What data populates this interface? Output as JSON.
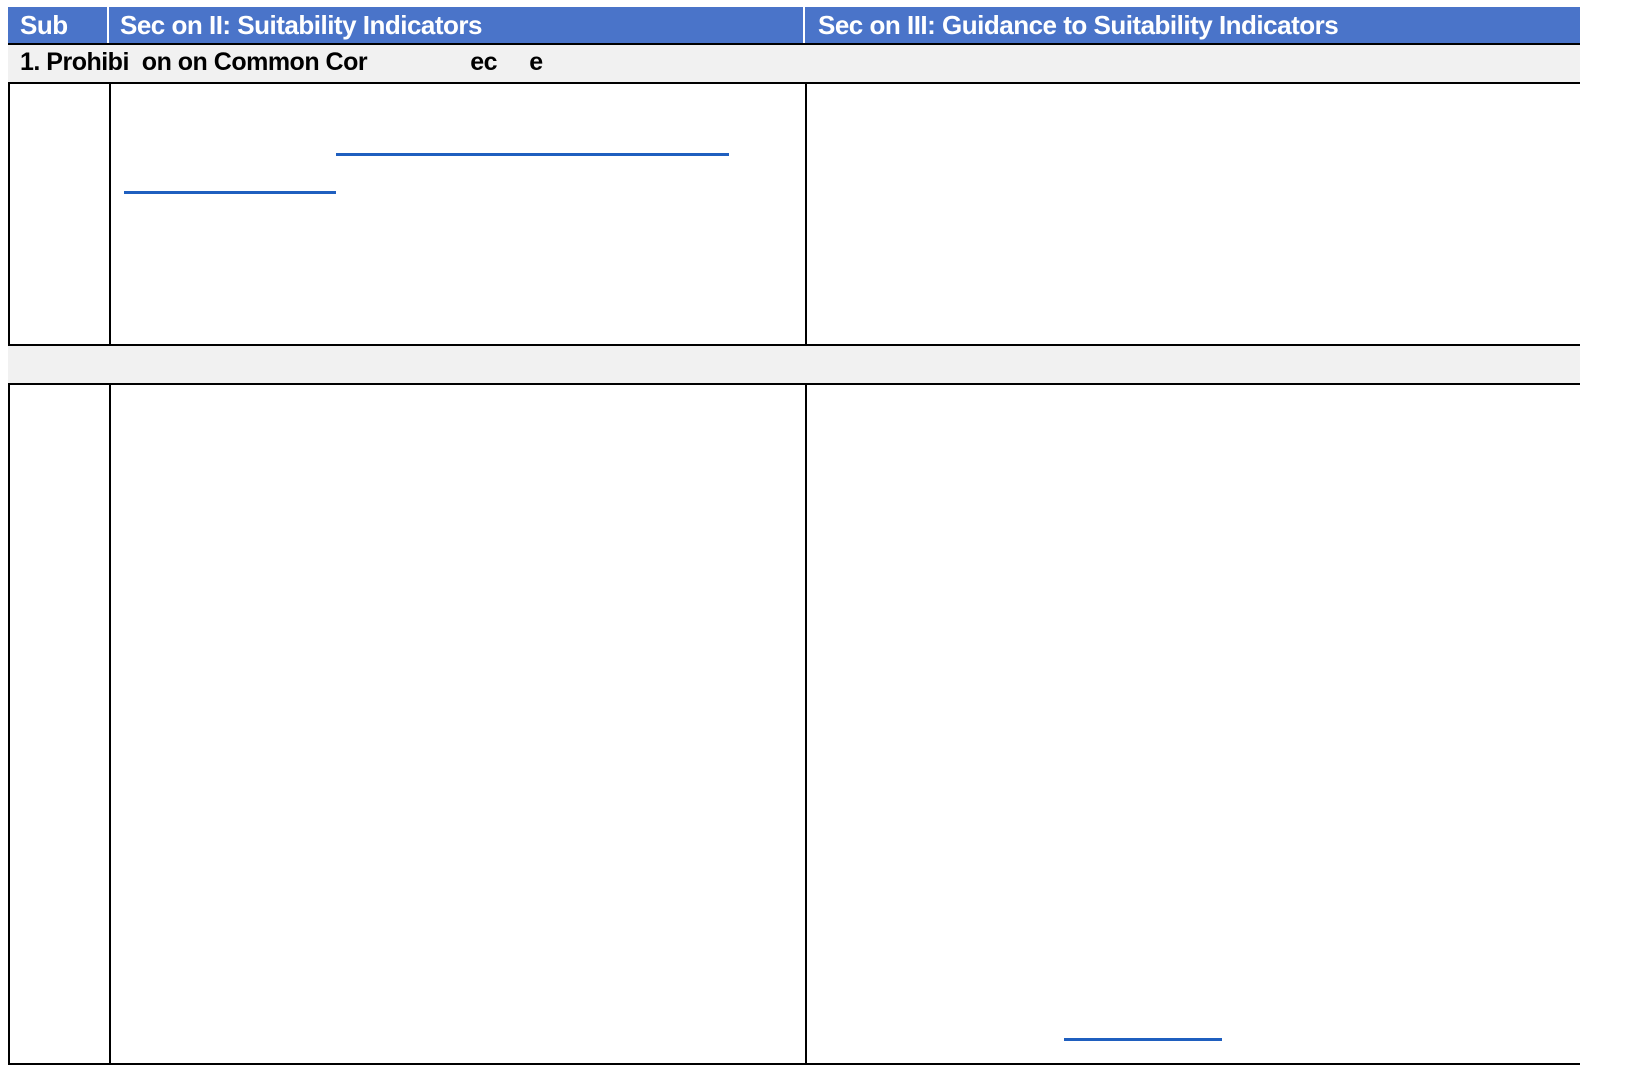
{
  "header": {
    "col_sub": "Sub",
    "col_section2": "Sec  on II: Suitability Indicators",
    "col_section3": "Sec  on III:  Guidance to Suitability Indicators",
    "background_color": "#4a74c9"
  },
  "bands": {
    "first": "1. Prohibi  on on Common Cor                ec     e",
    "second": ""
  },
  "colors": {
    "band_background": "#f1f1f1",
    "link_color": "#1f5fbf",
    "border_color": "#000000"
  }
}
